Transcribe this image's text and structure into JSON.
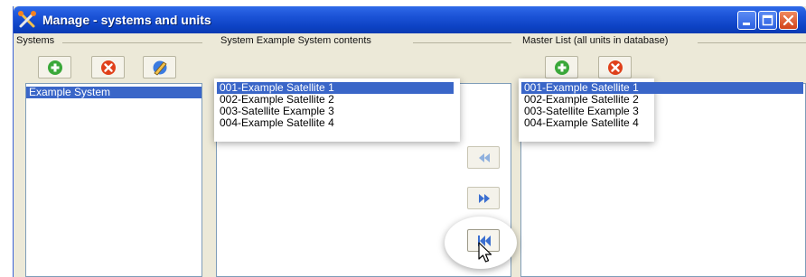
{
  "window": {
    "title": "Manage - systems and units"
  },
  "systems_panel": {
    "label": "Systems",
    "items": [
      "Example System"
    ],
    "selected_index": 0
  },
  "contents_panel": {
    "label": "System Example System contents",
    "items": [
      "001-Example Satellite 1",
      "002-Example Satellite 2",
      "003-Satellite Example 3",
      "004-Example Satellite 4"
    ],
    "selected_index": 0
  },
  "master_panel": {
    "label": "Master List (all units in database)",
    "items": [
      "001-Example Satellite 1",
      "002-Example Satellite 2",
      "003-Satellite Example 3",
      "004-Example Satellite 4"
    ],
    "selected_index": 0
  },
  "icons": {
    "app": "tools-icon",
    "add": "add-icon",
    "remove": "remove-icon",
    "edit": "edit-pencil-icon",
    "move_left": "double-left-arrow-icon",
    "move_right": "double-right-arrow-icon",
    "move_all": "move-all-icon"
  },
  "colors": {
    "titlebar": "#1c54d8",
    "selection": "#3a66c8",
    "add": "#3aa83a",
    "remove": "#e0401a",
    "window_bg": "#ece9d8"
  }
}
